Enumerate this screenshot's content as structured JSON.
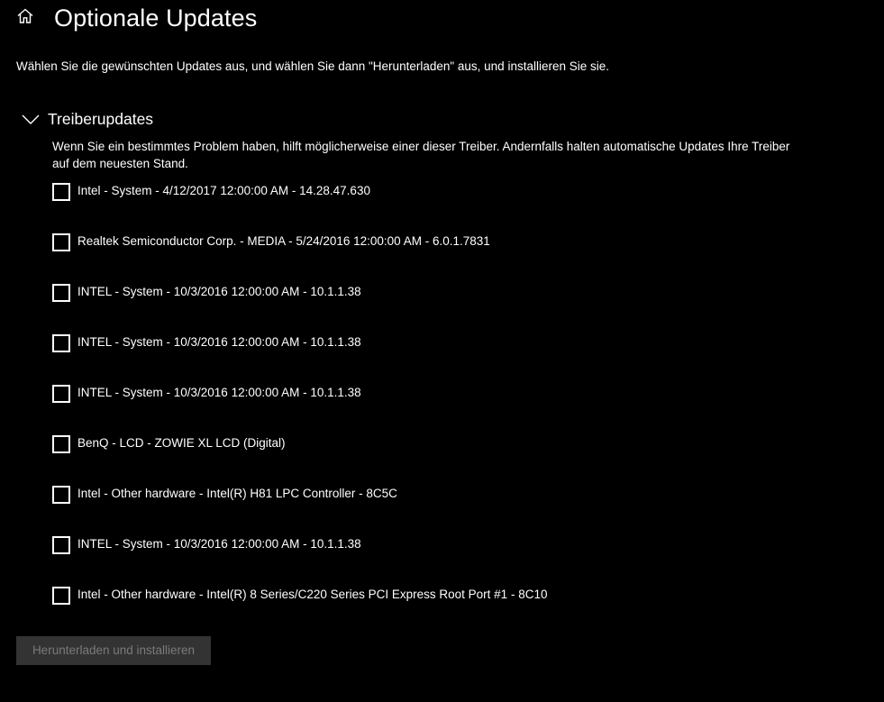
{
  "header": {
    "title": "Optionale Updates",
    "home_icon": "home-icon"
  },
  "intro": "Wählen Sie die gewünschten Updates aus, und wählen Sie dann \"Herunterladen\" aus, und installieren Sie sie.",
  "section": {
    "title": "Treiberupdates",
    "expanded": true,
    "chevron_icon": "chevron-down-icon",
    "description": "Wenn Sie ein bestimmtes Problem haben, hilft möglicherweise einer dieser Treiber. Andernfalls halten automatische Updates Ihre Treiber auf dem neuesten Stand.",
    "drivers": [
      {
        "label": "Intel - System - 4/12/2017 12:00:00 AM - 14.28.47.630",
        "checked": false
      },
      {
        "label": "Realtek Semiconductor Corp. - MEDIA - 5/24/2016 12:00:00 AM - 6.0.1.7831",
        "checked": false
      },
      {
        "label": "INTEL - System - 10/3/2016 12:00:00 AM - 10.1.1.38",
        "checked": false
      },
      {
        "label": "INTEL - System - 10/3/2016 12:00:00 AM - 10.1.1.38",
        "checked": false
      },
      {
        "label": "INTEL - System - 10/3/2016 12:00:00 AM - 10.1.1.38",
        "checked": false
      },
      {
        "label": "BenQ - LCD - ZOWIE XL LCD (Digital)",
        "checked": false
      },
      {
        "label": "Intel - Other hardware - Intel(R) H81 LPC Controller - 8C5C",
        "checked": false
      },
      {
        "label": "INTEL - System - 10/3/2016 12:00:00 AM - 10.1.1.38",
        "checked": false
      },
      {
        "label": "Intel - Other hardware - Intel(R) 8 Series/C220 Series PCI Express Root Port #1 - 8C10",
        "checked": false
      }
    ]
  },
  "install_button": {
    "label": "Herunterladen und installieren",
    "enabled": false
  },
  "colors": {
    "background": "#000000",
    "text": "#ffffff",
    "button_disabled_bg": "#333333",
    "button_disabled_text": "#7a7a7a"
  }
}
